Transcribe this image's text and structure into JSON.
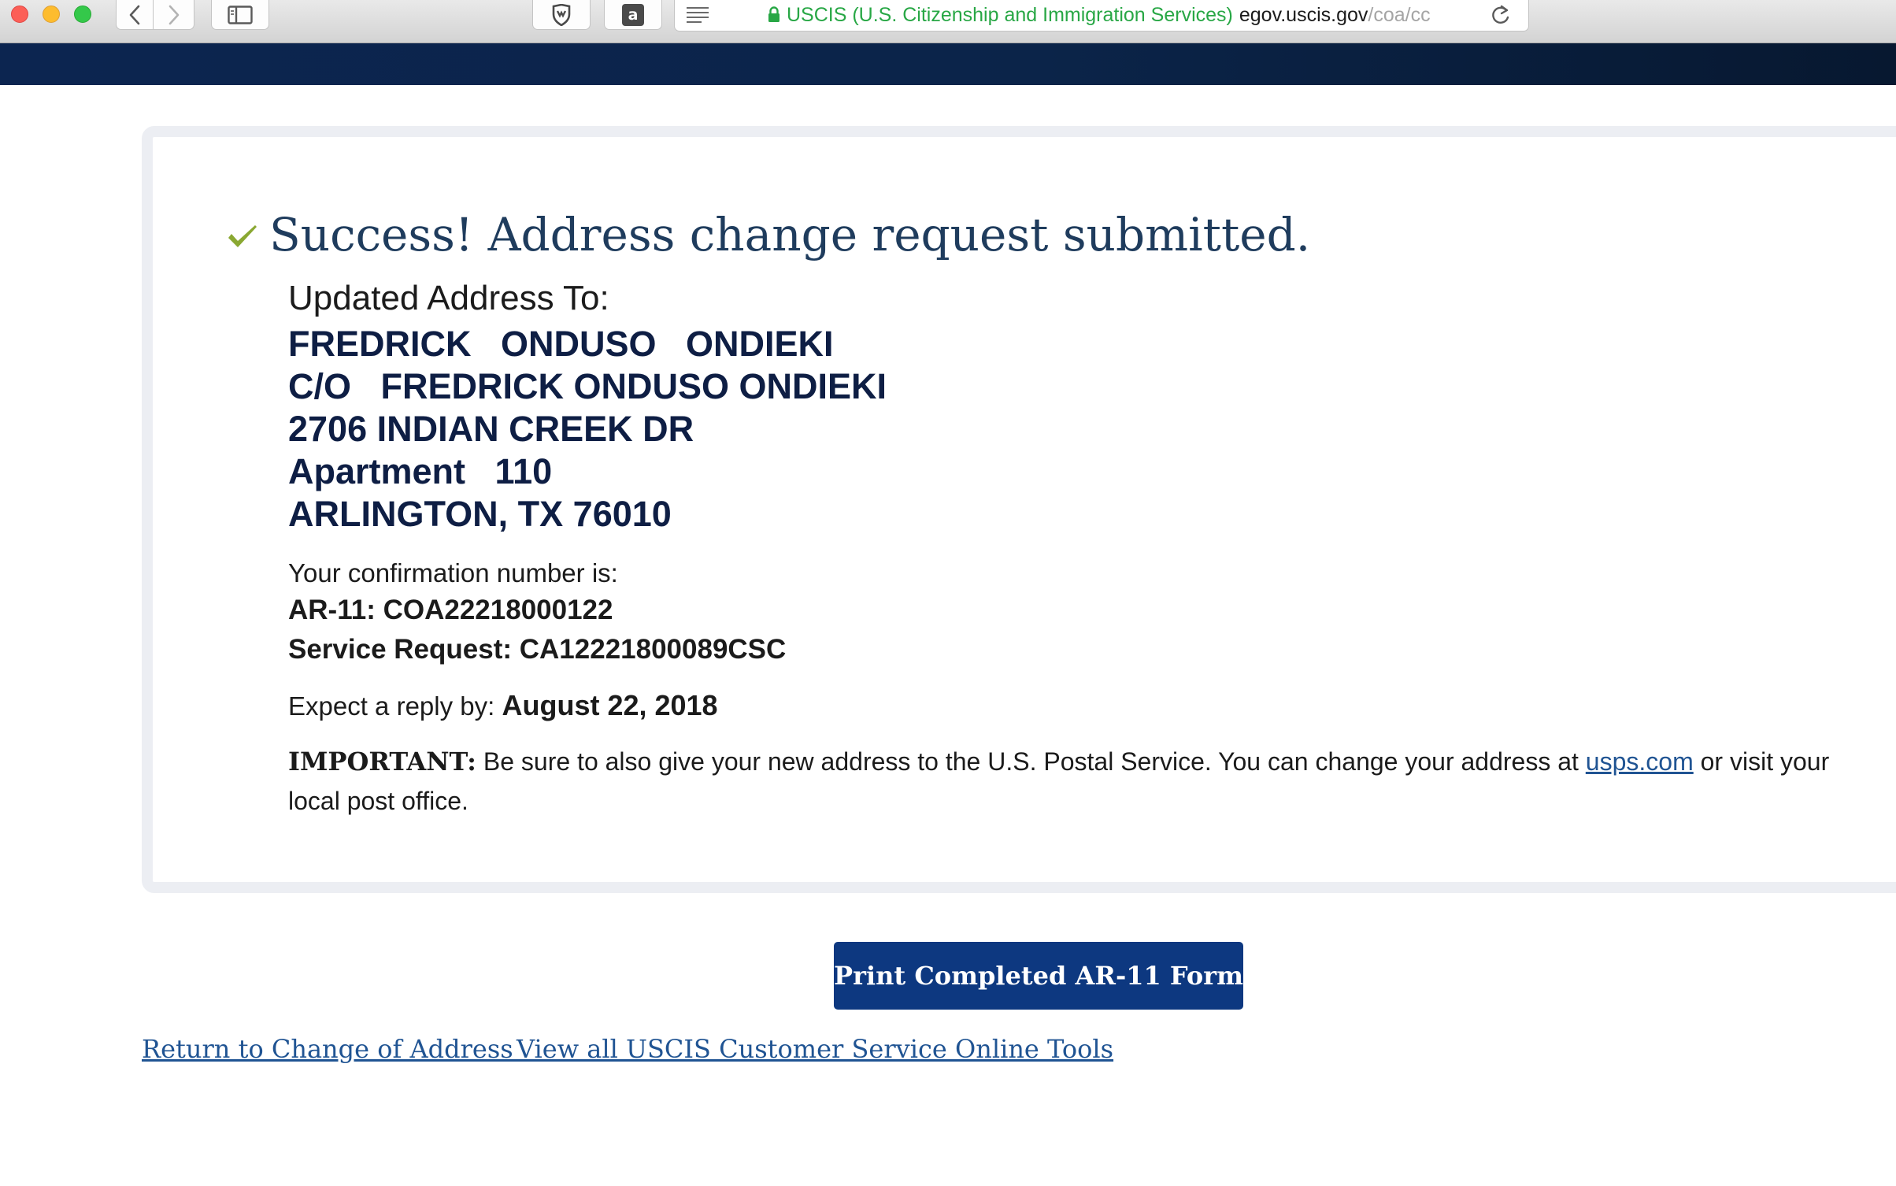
{
  "browser": {
    "site_name": "USCIS (U.S. Citizenship and Immigration Services)",
    "url_host": "egov.uscis.gov",
    "url_path": "/coa/cc"
  },
  "colors": {
    "header_navy": "#0b2449",
    "success_check": "#8aa832",
    "secure_green": "#28a745",
    "button_navy": "#0d3880",
    "link_blue": "#205493"
  },
  "icons": {
    "back": "chevron-left",
    "forward": "chevron-right",
    "sidebar": "sidebar",
    "extension_1": "shield",
    "extension_2": "amazon-a",
    "reader": "reader-lines",
    "lock": "lock",
    "reload": "reload-arrow",
    "success": "checkmark"
  },
  "confirmation": {
    "heading": "Success! Address change request submitted.",
    "updated_label": "Updated Address To:",
    "address_lines": [
      "FREDRICK   ONDUSO   ONDIEKI",
      "C/O   FREDRICK ONDUSO ONDIEKI",
      "2706 INDIAN CREEK DR",
      "Apartment   110",
      "ARLINGTON, TX 76010"
    ],
    "confirmation_label": "Your confirmation number is:",
    "ar11_line": "AR-11: COA22218000122",
    "service_request_line": "Service Request: CA12221800089CSC",
    "reply_label": "Expect a reply by:",
    "reply_date": "August 22, 2018",
    "important_label": "IMPORTANT:",
    "important_text": "Be sure to also give your new address to the U.S. Postal Service. You can change your address at",
    "usps_link": "usps.com",
    "important_text_end": "or visit your local post office."
  },
  "actions": {
    "print_button": "Print Completed AR-11 Form",
    "return_link": "Return to Change of Address ",
    "tools_link": "View all USCIS Customer Service Online Tools"
  }
}
